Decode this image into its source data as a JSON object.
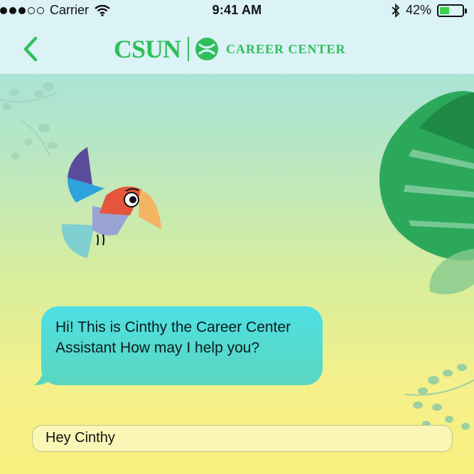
{
  "status_bar": {
    "carrier": "Carrier",
    "time": "9:41 AM",
    "battery": "42%",
    "battery_level": 0.42,
    "signal_bars": 3
  },
  "header": {
    "logo_text": "CSUN",
    "logo_subtitle": "CAREER CENTER",
    "back_icon": "chevron-left-icon"
  },
  "chat": {
    "bot_message": "Hi! This is Cinthy the Career Center Assistant How may I help you?",
    "mascot": "toucan-mascot"
  },
  "input": {
    "value": "Hey Cinthy"
  },
  "colors": {
    "brand_green": "#2fbf5a",
    "bubble": "#54dcd0",
    "input_bg": "#f9f6b6"
  }
}
